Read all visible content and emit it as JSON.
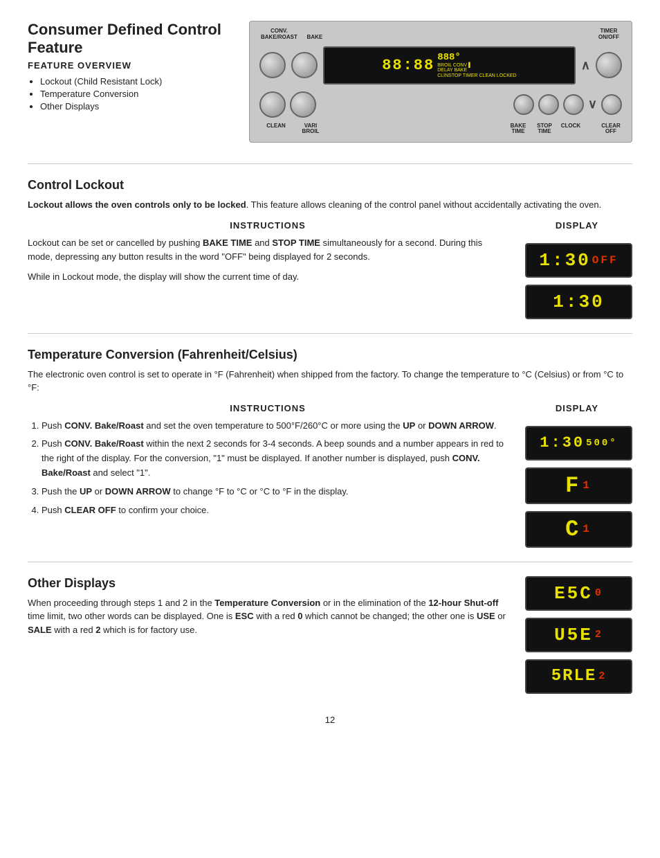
{
  "page": {
    "number": "12"
  },
  "top": {
    "title": "Consumer Defined Control Feature",
    "feature_overview_label": "FEATURE OVERVIEW",
    "bullet_items": [
      "Lockout (Child Resistant Lock)",
      "Temperature Conversion",
      "Other Displays"
    ]
  },
  "panel": {
    "top_labels": [
      "CONV. BAKE/ROAST",
      "BAKE"
    ],
    "display_time": "88:88",
    "display_indicators": "888°",
    "display_sub": "BROIL CONV\nDELAY BAKE\nCLINSTOP TIMER CLEAN LOCKED",
    "timer_label": "TIMER\nON/OFF",
    "bottom_labels": [
      "CLEAN",
      "VARI\nBROIL",
      "BAKE\nTIME",
      "STOP\nTIME",
      "CLOCK",
      "CLEAR\nOFF"
    ]
  },
  "control_lockout": {
    "title": "Control  Lockout",
    "intro": "Lockout allows the oven controls only to be locked. This feature allows cleaning of the control panel without accidentally activating the oven.",
    "instructions_header": "INSTRUCTIONS",
    "display_header": "DISPLAY",
    "instructions_text1": "Lockout can be set or cancelled by pushing ",
    "instructions_bold1": "BAKE TIME",
    "instructions_text2": " and ",
    "instructions_bold2": "STOP TIME",
    "instructions_text3": " simultaneously for a second. During this mode, depressing any button results in the word \"OFF\" being displayed for 2 seconds.",
    "instructions_text4": "While in Lockout mode, the display will show the current time of day.",
    "display1": "1:30",
    "display1_sub": "OFF",
    "display2": "1:30"
  },
  "temp_conversion": {
    "title": "Temperature  Conversion  (Fahrenheit/Celsius)",
    "intro": "The electronic oven control is set to operate in °F (Fahrenheit) when shipped from the factory.  To change the temperature to °C (Celsius) or from °C to °F:",
    "instructions_header": "INSTRUCTIONS",
    "display_header": "DISPLAY",
    "steps": [
      {
        "bold": "CONV. Bake/Roast",
        "text": " and set the oven temperature to 500°F/260°C or more using the ",
        "bold2": "UP",
        "text2": " or ",
        "bold3": "DOWN ARROW",
        "text3": "."
      },
      {
        "bold": "CONV. Bake/Roast",
        "text": " within the next 2 seconds for 3-4 seconds.  A beep sounds and a number appears in red to the right of the display.  For the conversion, \"1\" must be displayed.  If another number is displayed, push ",
        "bold2": "CONV. Bake/Roast",
        "text2": " and select \"1\"."
      },
      {
        "text": "Push the ",
        "bold": "UP",
        "text2": " or ",
        "bold2": "DOWN ARROW",
        "text3": " to change °F to °C or °C to °F in the display."
      },
      {
        "text": "Push ",
        "bold": "CLEAR OFF",
        "text2": " to confirm your choice."
      }
    ],
    "display1": "1:30",
    "display1_sub": "500°",
    "display2": "F",
    "display2_sup": "1",
    "display3": "C",
    "display3_sup": "1"
  },
  "other_displays": {
    "title": "Other  Displays",
    "intro1": "When proceeding through steps 1 and 2 in the ",
    "intro_bold1": "Temperature Conversion",
    "intro2": " or in the elimination of the ",
    "intro_bold2": "12-hour Shut-off",
    "intro3": " time limit, two other words can be displayed. One is ",
    "intro_bold3": "ESC",
    "intro4": " with a red ",
    "intro_bold4": "0",
    "intro5": " which cannot be changed; the other one is ",
    "intro_bold5": "USE",
    "intro6": " or ",
    "intro_bold6": "SALE",
    "intro7": " with a red ",
    "intro_bold7": "2",
    "intro8": " which is for factory use.",
    "display1": "ESC",
    "display1_sup": "0",
    "display2": "USE",
    "display2_sup": "2",
    "display3": "SALE",
    "display3_sup": "2"
  }
}
